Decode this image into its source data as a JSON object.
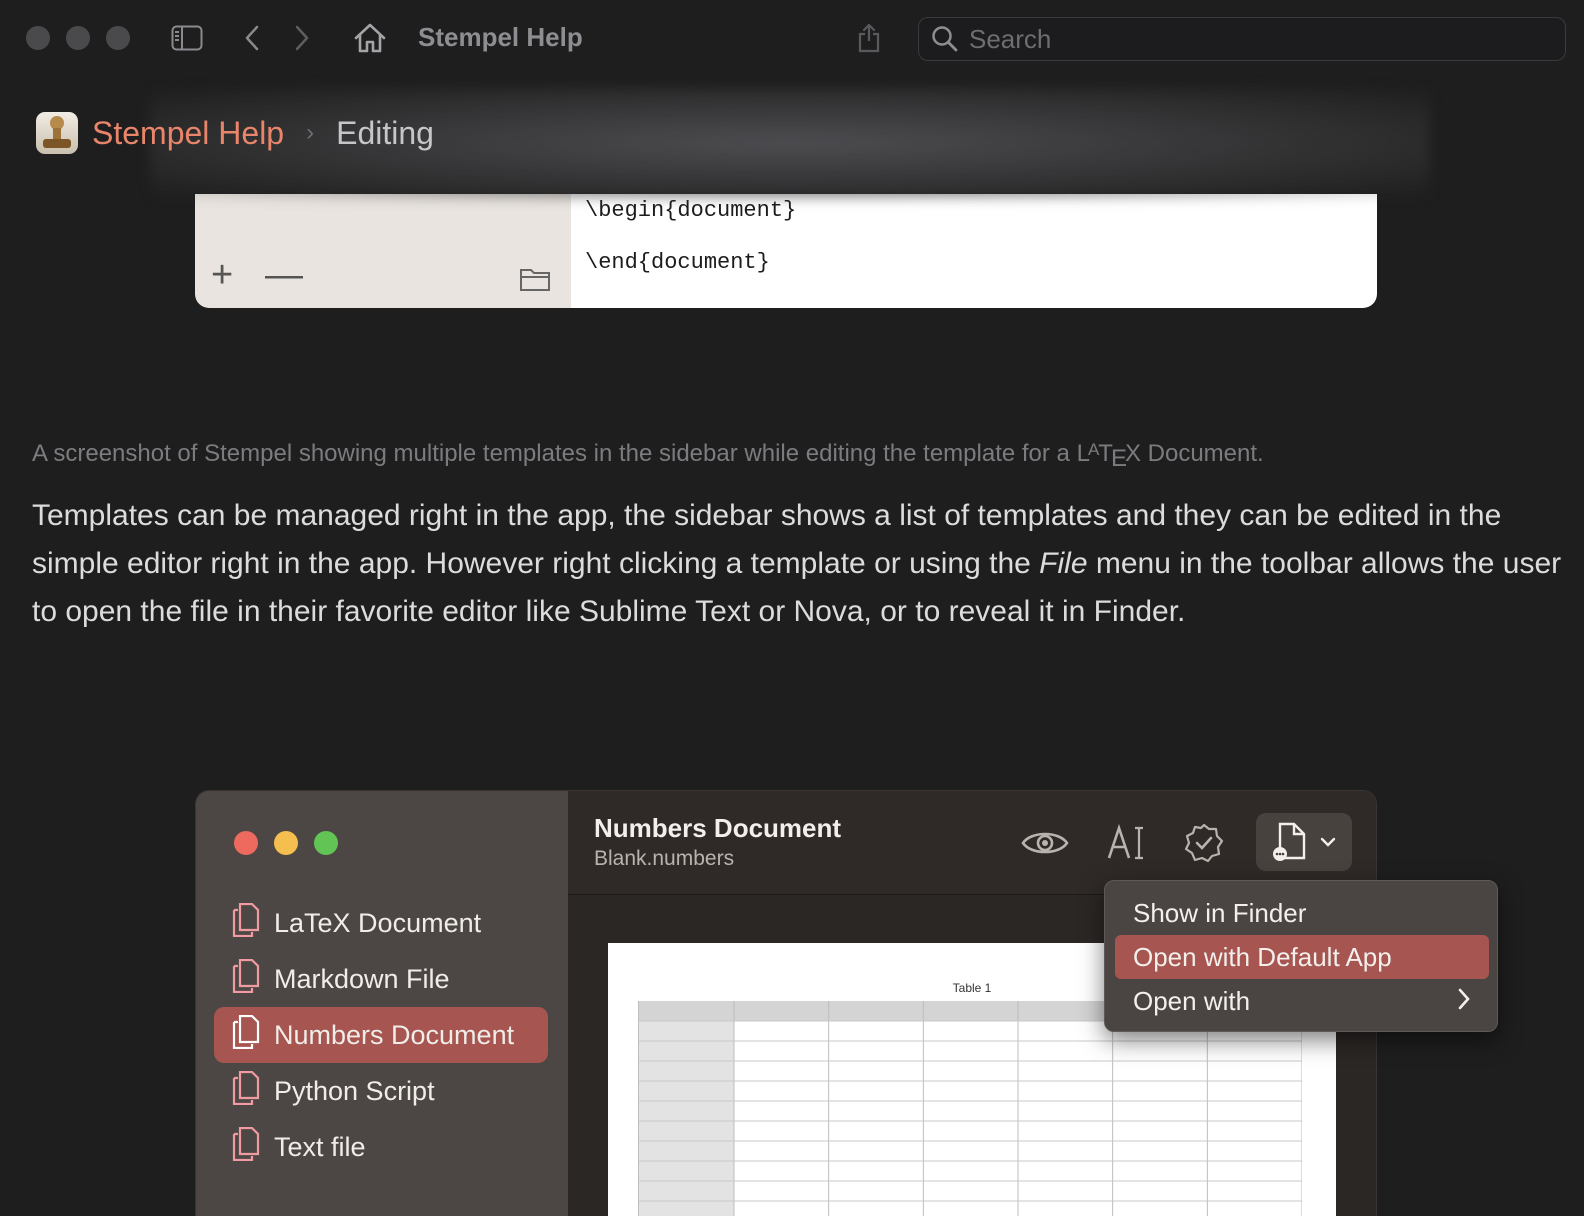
{
  "window": {
    "title": "Stempel Help",
    "search_placeholder": "Search"
  },
  "breadcrumb": {
    "root": "Stempel Help",
    "separator": "›",
    "current": "Editing"
  },
  "figure1": {
    "code_lines": [
      "\\begin{document}",
      "\\end{document}"
    ],
    "add_label": "+",
    "remove_label": "—"
  },
  "caption": {
    "prefix": "A screenshot of Stempel showing multiple templates in the sidebar while editing the template for a ",
    "latex_L": "L",
    "latex_A": "A",
    "latex_T": "T",
    "latex_E": "E",
    "latex_X": "X",
    "suffix": " Document."
  },
  "paragraph": {
    "part1": "Templates can be managed right in the app, the sidebar shows a list of templates and they can be edited in the simple editor right in the app. However right clicking a template or using the ",
    "emphasis": "File",
    "part2": " menu in the toolbar allows the user to open the file in their favorite editor like Sublime Text or Nova, or to reveal it in Finder."
  },
  "figure2": {
    "sidebar_items": [
      {
        "label": "LaTeX Document",
        "selected": false
      },
      {
        "label": "Markdown File",
        "selected": false
      },
      {
        "label": "Numbers Document",
        "selected": true
      },
      {
        "label": "Python Script",
        "selected": false
      },
      {
        "label": "Text file",
        "selected": false
      }
    ],
    "toolbar": {
      "title": "Numbers Document",
      "subtitle": "Blank.numbers"
    },
    "preview": {
      "table_title": "Table 1"
    },
    "context_menu": {
      "items": [
        "Show in Finder",
        "Open with Default App",
        "Open with"
      ],
      "highlighted": "Open with Default App"
    },
    "colors": {
      "accent": "#a65550",
      "sidebar_bg": "#4c4744",
      "icon_pink": "#f09aa2"
    }
  },
  "icons": [
    "sidebar-toggle-icon",
    "back-icon",
    "forward-icon",
    "home-icon",
    "share-icon",
    "search-icon",
    "eye-icon",
    "text-format-icon",
    "verified-badge-icon",
    "file-menu-icon",
    "chevron-down-icon",
    "chevron-right-icon",
    "folder-icon",
    "document-icon"
  ]
}
